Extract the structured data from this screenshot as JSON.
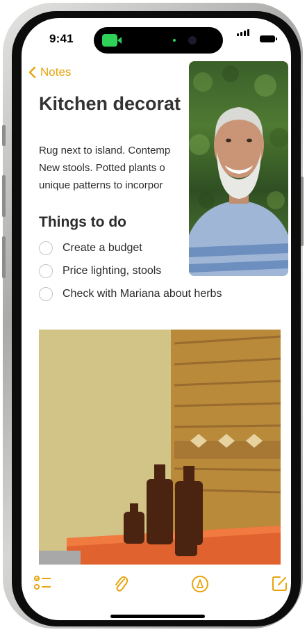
{
  "status_bar": {
    "time": "9:41"
  },
  "nav": {
    "back_label": "Notes"
  },
  "note": {
    "title": "Kitchen decorat",
    "body_lines": [
      "Rug next to island. Contemp",
      "New stools. Potted plants o",
      "unique patterns to incorpor"
    ],
    "section_heading": "Things to do",
    "todos": [
      {
        "label": "Create a budget",
        "checked": false
      },
      {
        "label": "Price lighting, stools",
        "checked": false
      },
      {
        "label": "Check with Mariana about herbs",
        "checked": false
      }
    ]
  },
  "toolbar": {
    "items": [
      "checklist-icon",
      "paperclip-icon",
      "markup-pen-icon",
      "compose-icon"
    ]
  },
  "colors": {
    "accent": "#e8a40c",
    "facetime_green": "#30d158",
    "text": "#2b2b2b"
  }
}
